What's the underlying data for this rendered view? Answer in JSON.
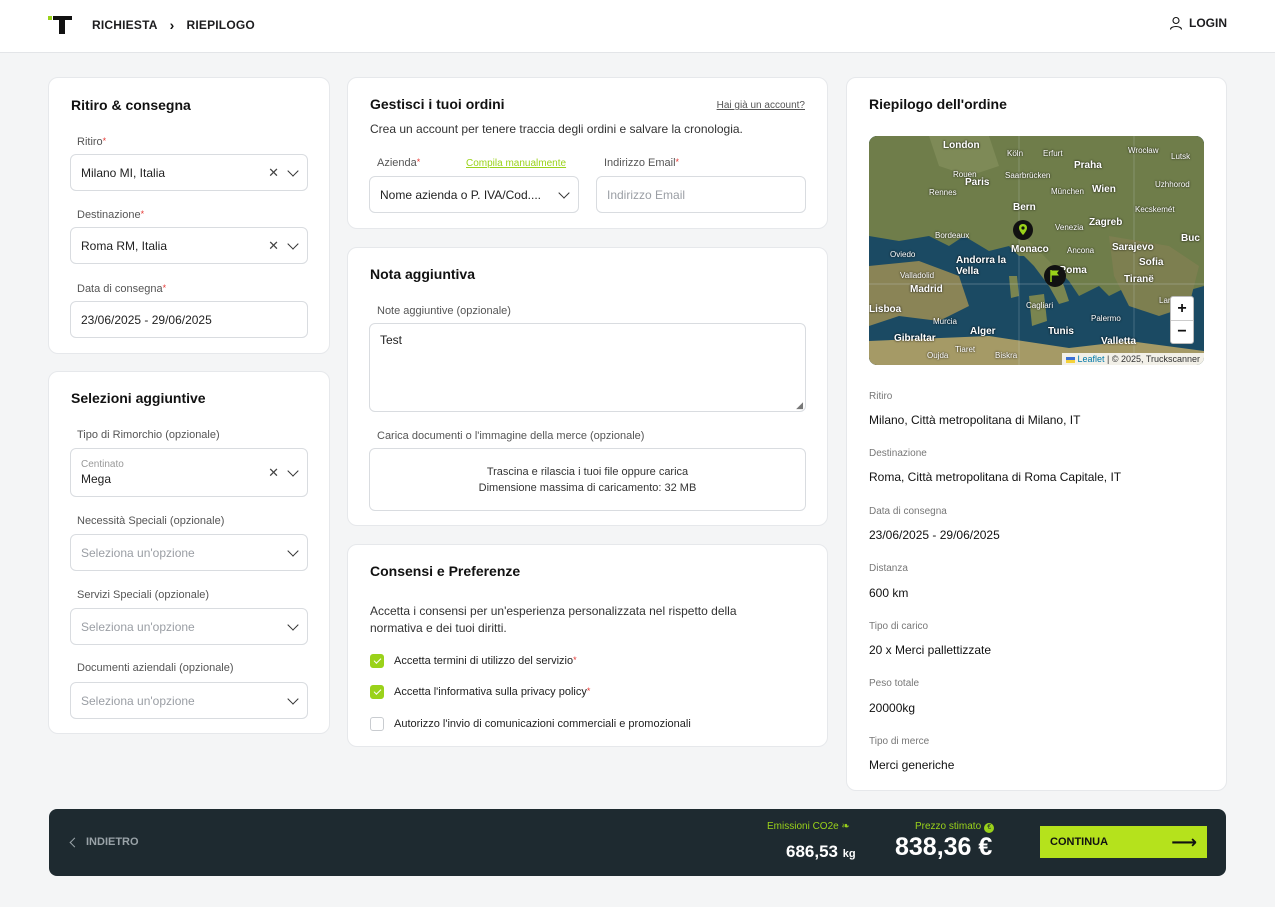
{
  "header": {
    "breadcrumb": [
      "RICHIESTA",
      "RIEPILOGO"
    ],
    "login_label": "LOGIN"
  },
  "pickup_card": {
    "title": "Ritiro & consegna",
    "pickup_label": "Ritiro",
    "pickup_value": "Milano MI, Italia",
    "destination_label": "Destinazione",
    "destination_value": "Roma RM, Italia",
    "date_label": "Data di consegna",
    "date_value": "23/06/2025 - 29/06/2025"
  },
  "extras_card": {
    "title": "Selezioni aggiuntive",
    "trailer_label": "Tipo di Rimorchio (opzionale)",
    "trailer_sub": "Centinato",
    "trailer_value": "Mega",
    "special_needs_label": "Necessità Speciali (opzionale)",
    "special_services_label": "Servizi Speciali (opzionale)",
    "company_docs_label": "Documenti aziendali (opzionale)",
    "select_placeholder": "Seleziona un'opzione"
  },
  "orders_card": {
    "title": "Gestisci i tuoi ordini",
    "account_link": "Hai già un account?",
    "description": "Crea un account per tenere traccia degli ordini e salvare la cronologia.",
    "company_label": "Azienda",
    "manual_link": "Compila manualmente",
    "company_value": "Nome azienda o P. IVA/Cod....",
    "email_label": "Indirizzo Email",
    "email_placeholder": "Indirizzo Email"
  },
  "note_card": {
    "title": "Nota aggiuntiva",
    "notes_label": "Note aggiuntive (opzionale)",
    "notes_value": "Test",
    "upload_label": "Carica documenti o l'immagine della merce (opzionale)",
    "upload_line1": "Trascina e rilascia i tuoi file oppure carica",
    "upload_line2": "Dimensione massima di caricamento: 32 MB"
  },
  "consent_card": {
    "title": "Consensi e Preferenze",
    "description": "Accetta i consensi per un'esperienza personalizzata nel rispetto della normativa e dei tuoi diritti.",
    "items": [
      {
        "label": "Accetta termini di utilizzo del servizio",
        "required": true,
        "checked": true
      },
      {
        "label": "Accetta l'informativa sulla privacy policy",
        "required": true,
        "checked": true
      },
      {
        "label": "Autorizzo l'invio di comunicazioni commerciali e promozionali",
        "required": false,
        "checked": false
      }
    ]
  },
  "summary_card": {
    "title": "Riepilogo dell'ordine",
    "map": {
      "zoom_in": "+",
      "zoom_out": "−",
      "attribution_leaflet": "Leaflet",
      "attribution_rest": " | © 2025, Truckscanner",
      "cities": [
        "London",
        "Köln",
        "Erfurt",
        "Wrocław",
        "Praha",
        "Lutsk",
        "Rouen",
        "Saarbrücken",
        "Paris",
        "München",
        "Wien",
        "Uzhhorod",
        "Rennes",
        "Bern",
        "Kecskemét",
        "Zagreb",
        "Bordeaux",
        "Venezia",
        "Monaco",
        "Sarajevo",
        "Ancona",
        "Andorra la Vella",
        "Roma",
        "Sofia",
        "Valladolid",
        "Tiranë",
        "Madrid",
        "Cagliari",
        "Lisboa",
        "Murcia",
        "Palermo",
        "Alger",
        "Tunis",
        "Gibraltar",
        "Valletta",
        "Oujda",
        "Tiaret",
        "Biskra",
        "Buc",
        "Larissa",
        "Oviedo"
      ]
    },
    "rows": [
      {
        "label": "Ritiro",
        "value": "Milano, Città metropolitana di Milano, IT"
      },
      {
        "label": "Destinazione",
        "value": "Roma, Città metropolitana di Roma Capitale, IT"
      },
      {
        "label": "Data di consegna",
        "value": "23/06/2025 - 29/06/2025"
      },
      {
        "label": "Distanza",
        "value": "600 km"
      },
      {
        "label": "Tipo di carico",
        "value": "20 x Merci pallettizzate"
      },
      {
        "label": "Peso totale",
        "value": "20000kg"
      },
      {
        "label": "Tipo di merce",
        "value": "Merci generiche"
      }
    ]
  },
  "footer": {
    "back_label": "INDIETRO",
    "emissions_label": "Emissioni CO2e",
    "emissions_value": "686,53",
    "emissions_unit": "kg",
    "price_label": "Prezzo stimato",
    "price_value": "838,36 €",
    "continue_label": "CONTINUA"
  },
  "colors": {
    "accent": "#b5e21c",
    "footer_bg": "#1e2a30",
    "required": "#e53935"
  }
}
